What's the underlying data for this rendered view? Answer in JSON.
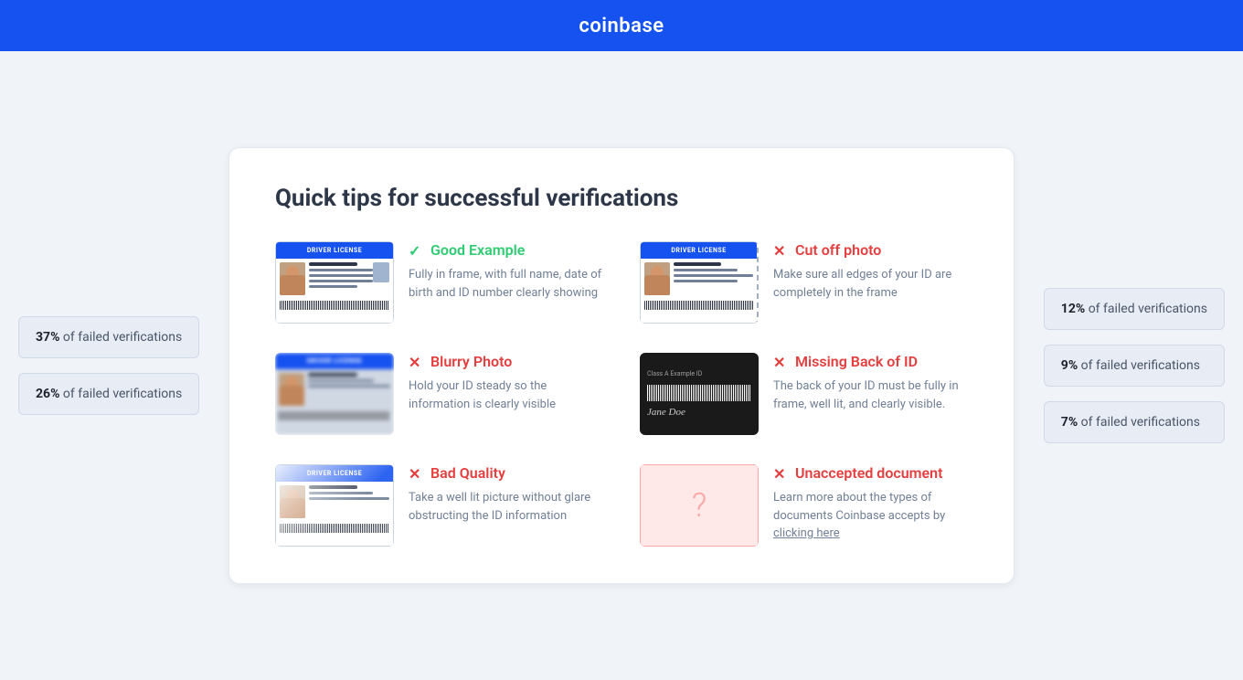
{
  "header": {
    "logo": "coinbase"
  },
  "page": {
    "title": "Quick tips for successful verifications"
  },
  "side_stats_left": [
    {
      "percent": "37%",
      "label": "of failed verifications"
    },
    {
      "percent": "26%",
      "label": "of failed verifications"
    }
  ],
  "side_stats_right": [
    {
      "percent": "12%",
      "label": "of failed verifications"
    },
    {
      "percent": "9%",
      "label": "of failed verifications"
    },
    {
      "percent": "7%",
      "label": "of failed verifications"
    }
  ],
  "tips": [
    {
      "id": "good-example",
      "icon_type": "check",
      "label": "Good Example",
      "label_class": "good",
      "image_type": "good",
      "description": "Fully in frame, with full name, date of birth and ID number clearly showing"
    },
    {
      "id": "cut-off-photo",
      "icon_type": "x",
      "label": "Cut off photo",
      "label_class": "bad",
      "image_type": "cutoff",
      "description": "Make sure all edges of your ID are completely in the frame"
    },
    {
      "id": "blurry-photo",
      "icon_type": "x",
      "label": "Blurry Photo",
      "label_class": "bad",
      "image_type": "blurry",
      "description": "Hold your ID steady so the information is clearly visible"
    },
    {
      "id": "missing-back",
      "icon_type": "x",
      "label": "Missing Back of ID",
      "label_class": "bad",
      "image_type": "back",
      "description": "The back of your ID must be fully in frame, well lit, and clearly visible."
    },
    {
      "id": "bad-quality",
      "icon_type": "x",
      "label": "Bad Quality",
      "label_class": "bad",
      "image_type": "bad",
      "description": "Take a well lit picture without glare obstructing the ID information"
    },
    {
      "id": "unaccepted-document",
      "icon_type": "x",
      "label": "Unaccepted document",
      "label_class": "bad",
      "image_type": "unknown",
      "description": "Learn more about the types of documents Coinbase accepts by",
      "link_text": "clicking here",
      "has_link": true
    }
  ]
}
